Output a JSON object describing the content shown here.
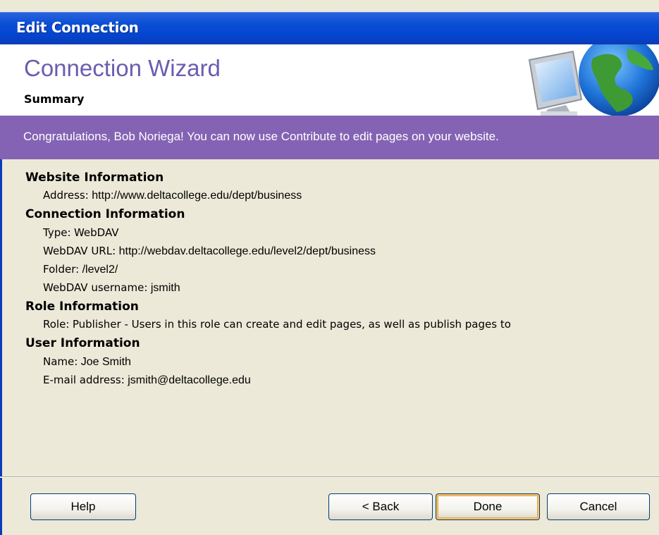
{
  "window": {
    "title": "Edit Connection"
  },
  "header": {
    "title": "Connection Wizard",
    "subtitle": "Summary",
    "art_icon": "monitor-globe-icon"
  },
  "banner": {
    "text": "Congratulations, Bob Noriega! You can now use Contribute to edit pages on your website."
  },
  "summary": {
    "website": {
      "heading": "Website Information",
      "address_label": "Address:",
      "address_value": "http://www.deltacollege.edu/dept/business"
    },
    "connection": {
      "heading": "Connection Information",
      "type_label": "Type:",
      "type_value": "WebDAV",
      "url_label": "WebDAV URL:",
      "url_value": "http://webdav.deltacollege.edu/level2/dept/business",
      "folder_label": "Folder:",
      "folder_value": "/level2/",
      "username_label": "WebDAV username:",
      "username_value": "jsmith"
    },
    "role": {
      "heading": "Role Information",
      "role_label": "Role:",
      "role_value": "Publisher - Users in this role can create and edit pages, as well as publish pages to"
    },
    "user": {
      "heading": "User Information",
      "name_label": "Name:",
      "name_value": "Joe Smith",
      "email_label": "E-mail address:",
      "email_value": "jsmith@deltacollege.edu"
    }
  },
  "footer": {
    "help": "Help",
    "back": "< Back",
    "done": "Done",
    "cancel": "Cancel"
  },
  "colors": {
    "titlebar": "#0a4fd6",
    "banner": "#8463b4",
    "header_title": "#6b5cb0",
    "dialog_bg": "#ece9d8"
  }
}
